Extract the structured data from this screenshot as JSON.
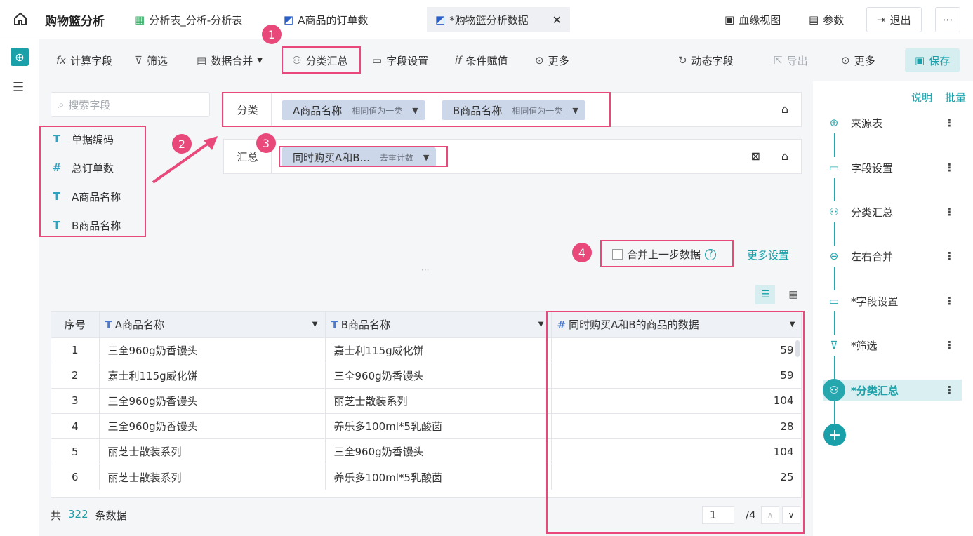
{
  "header": {
    "title": "购物篮分析",
    "tabs": [
      {
        "label": "分析表_分析-分析表"
      },
      {
        "label": "A商品的订单数"
      },
      {
        "label": "*购物篮分析数据"
      }
    ],
    "lineage_label": "血缘视图",
    "params_label": "参数",
    "exit_label": "退出"
  },
  "toolbar": {
    "calc_field": "计算字段",
    "filter": "筛选",
    "merge": "数据合并",
    "group_summary": "分类汇总",
    "field_settings": "字段设置",
    "conditional": "条件赋值",
    "more": "更多",
    "dynamic_field": "动态字段",
    "export": "导出",
    "more_right": "更多",
    "save": "保存"
  },
  "fields_panel": {
    "search_placeholder": "搜索字段",
    "fields": [
      "单据编码",
      "总订单数",
      "A商品名称",
      "B商品名称"
    ]
  },
  "group": {
    "label": "分类",
    "pills": [
      {
        "name": "A商品名称",
        "mode": "相同值为一类"
      },
      {
        "name": "B商品名称",
        "mode": "相同值为一类"
      }
    ]
  },
  "summary": {
    "label": "汇总",
    "pill": {
      "name": "同时购买A和B...",
      "mode": "去重计数"
    }
  },
  "merge_option": {
    "label": "合并上一步数据",
    "more_settings": "更多设置"
  },
  "badges": [
    "1",
    "2",
    "3",
    "4"
  ],
  "table": {
    "headers": [
      "序号",
      "A商品名称",
      "B商品名称",
      "同时购买A和B的商品的数据"
    ],
    "rows": [
      [
        "1",
        "三全960g奶香馒头",
        "嘉士利115g威化饼",
        "59"
      ],
      [
        "2",
        "嘉士利115g威化饼",
        "三全960g奶香馒头",
        "59"
      ],
      [
        "3",
        "三全960g奶香馒头",
        "丽芝士散装系列",
        "104"
      ],
      [
        "4",
        "三全960g奶香馒头",
        "养乐多100ml*5乳酸菌",
        "28"
      ],
      [
        "5",
        "丽芝士散装系列",
        "三全960g奶香馒头",
        "104"
      ],
      [
        "6",
        "丽芝士散装系列",
        "养乐多100ml*5乳酸菌",
        "25"
      ]
    ]
  },
  "footer": {
    "prefix": "共",
    "count": "322",
    "suffix": "条数据",
    "page": "1",
    "total_pages": "/4"
  },
  "sidebar": {
    "help": "说明",
    "batch": "批量",
    "steps": [
      {
        "label": "来源表",
        "icon": "source-icon"
      },
      {
        "label": "字段设置",
        "icon": "field-settings-icon"
      },
      {
        "label": "分类汇总",
        "icon": "group-summary-icon"
      },
      {
        "label": "左右合并",
        "icon": "join-icon"
      },
      {
        "label": "*字段设置",
        "icon": "field-settings-icon"
      },
      {
        "label": "*筛选",
        "icon": "filter-icon"
      },
      {
        "label": "*分类汇总",
        "icon": "group-summary-icon"
      }
    ]
  },
  "colors": {
    "accent": "#1aa0a8",
    "highlight": "#e8497a",
    "pill": "#cdd7ea"
  }
}
